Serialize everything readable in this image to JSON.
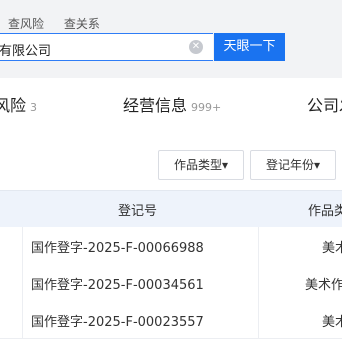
{
  "header": {
    "links": [
      "查风险",
      "查关系"
    ],
    "search_value": "有限公司",
    "search_button": "天眼一下"
  },
  "tabs": [
    {
      "label": "风险",
      "count": "3"
    },
    {
      "label": "经营信息",
      "count": "999+"
    },
    {
      "label": "公司发"
    }
  ],
  "filters": {
    "work_type": "作品类型▾",
    "reg_year": "登记年份▾"
  },
  "table": {
    "headers": [
      "登记号",
      "作品类"
    ],
    "rows": [
      {
        "number": "国作登字-2025-F-00066988",
        "type": "美术"
      },
      {
        "number": "国作登字-2025-F-00034561",
        "type": "美术作"
      },
      {
        "number": "国作登字-2025-F-00023557",
        "type": "美术"
      }
    ]
  }
}
